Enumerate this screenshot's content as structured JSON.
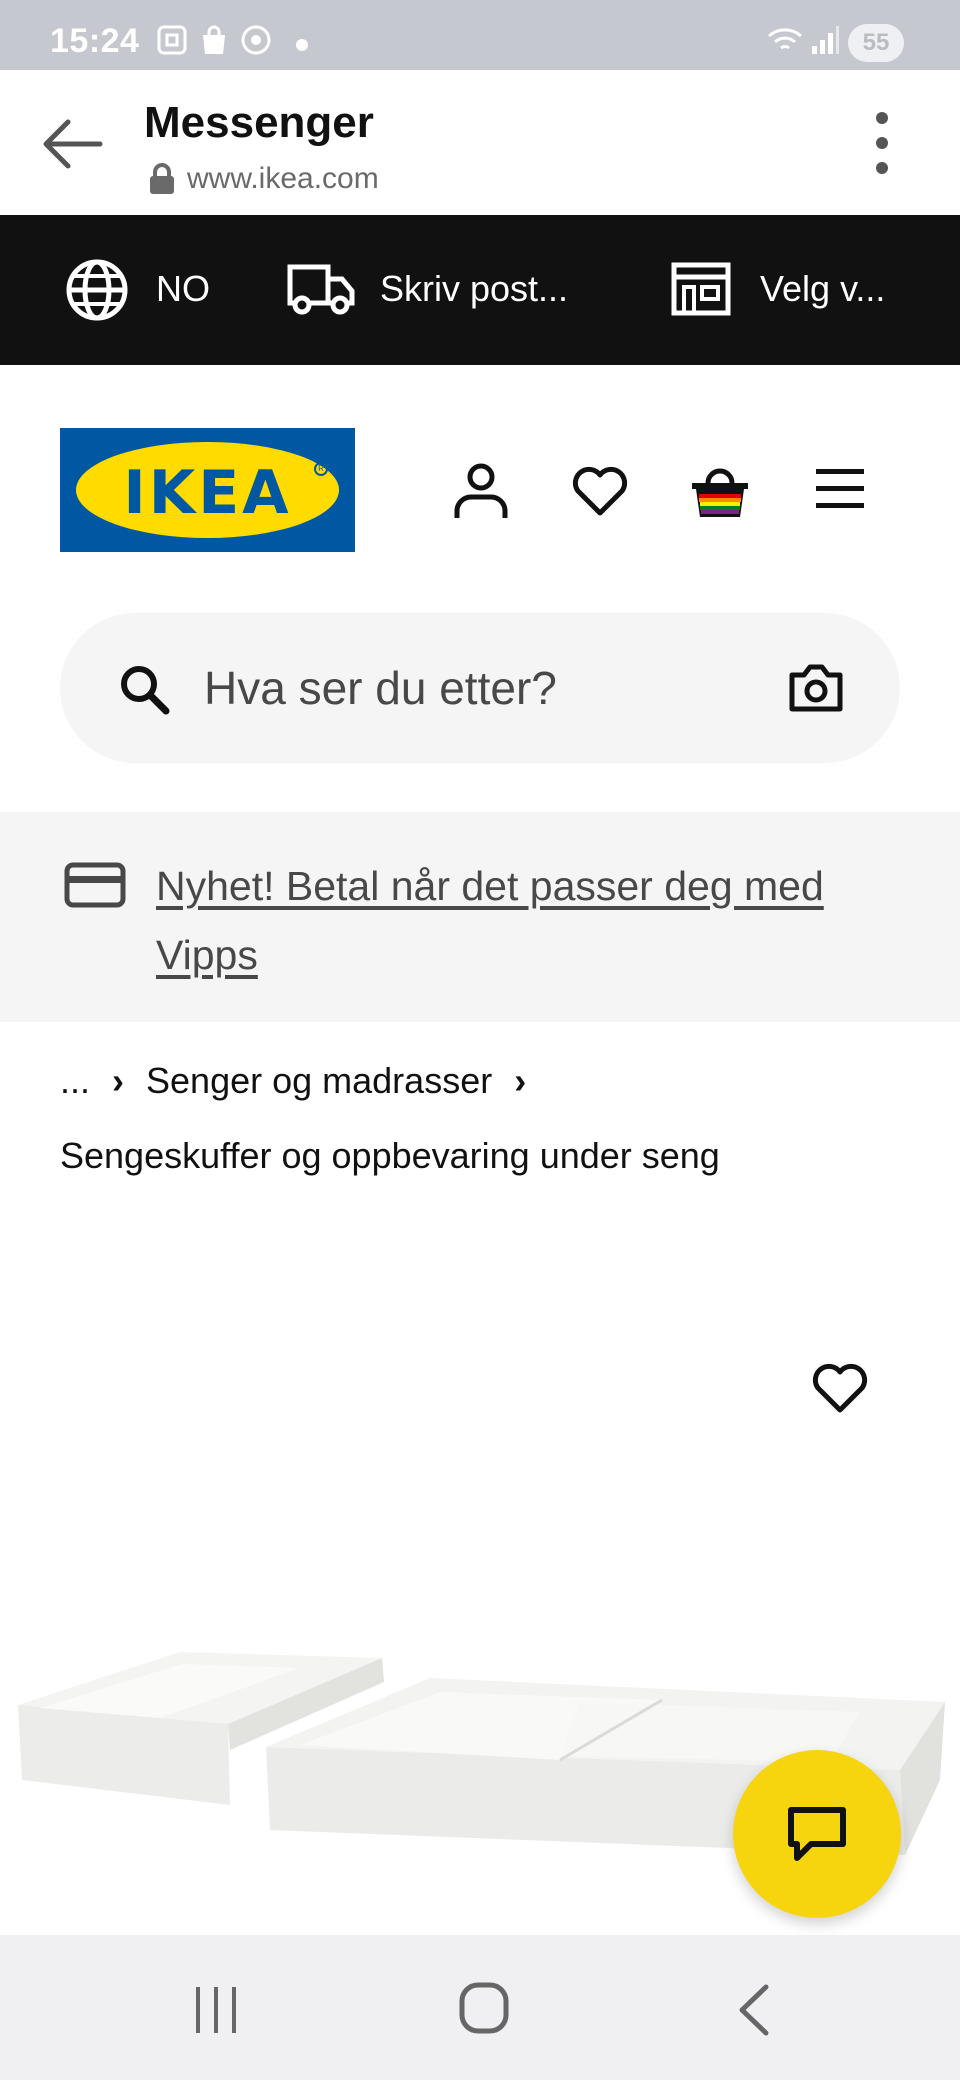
{
  "status_bar": {
    "time": "15:24",
    "battery": "55",
    "icons": [
      "screenshot-icon",
      "shopping-bag-icon",
      "chrome-icon",
      "dot-icon",
      "wifi-icon",
      "signal-icon"
    ]
  },
  "app_bar": {
    "title": "Messenger",
    "url": "www.ikea.com",
    "back_icon": "back-arrow-icon",
    "menu_icon": "more-vert-icon"
  },
  "top_band": {
    "country": "NO",
    "postal": "Skriv post...",
    "store": "Velg v..."
  },
  "header": {
    "logo_text": "IKEA",
    "icons": [
      "profile-icon",
      "heart-icon",
      "basket-icon",
      "hamburger-menu-icon"
    ]
  },
  "search": {
    "placeholder": "Hva ser du etter?"
  },
  "banner": {
    "text": "Nyhet! Betal når det passer deg med Vipps"
  },
  "breadcrumb": {
    "ellipsis": "...",
    "level1": "Senger og madrasser",
    "current": "Sengeskuffer og oppbevaring under seng"
  },
  "colors": {
    "brand_blue": "#0058a3",
    "brand_yellow": "#ffdb00",
    "chat_yellow": "#f6d40e",
    "top_band": "#111111"
  }
}
